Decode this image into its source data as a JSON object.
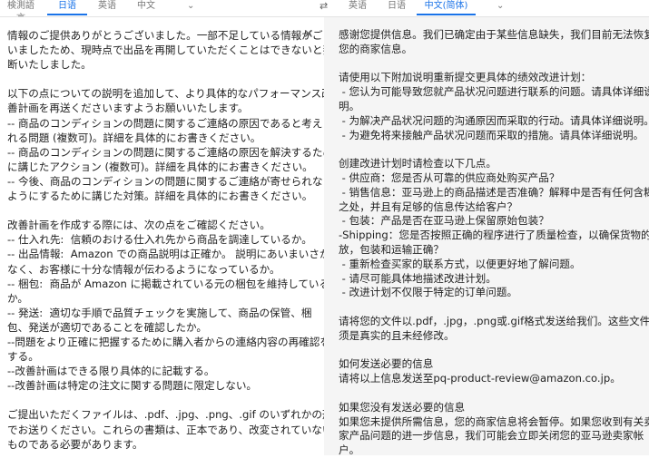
{
  "source_tabs": [
    "検測語言",
    "日语",
    "英语",
    "中文"
  ],
  "target_tabs": [
    "英语",
    "日语",
    "中文(简体)"
  ],
  "icons": {
    "swap": "swap-languages-icon",
    "chevron": "chevron-down-icon",
    "close": "close-icon"
  },
  "accent_color": "#1a73e8",
  "source_lines": [
    "情報のご提供ありがとうございました。一部不足している情報がござ",
    "いましたため、現時点で出品を再開していただくことはできないと判",
    "断いたしました。",
    "",
    "以下の点についての説明を追加して、より具体的なパフォーマンス改",
    "善計画を再送くださいますようお願いいたします。",
    "-- 商品のコンディションの問題に関するご連絡の原因であると考えら",
    "れる問題 (複数可)。詳細を具体的にお書きください。",
    "-- 商品のコンディションの問題に関するご連絡の原因を解決するため",
    "に講じたアクション (複数可)。詳細を具体的にお書きください。",
    "-- 今後、商品のコンディションの問題に関するご連絡が寄せられない",
    "ようにするために講じた対策。詳細を具体的にお書きください。",
    "",
    "改善計画を作成する際には、次の点をご確認ください。",
    "-- 仕入れ先:  信頼のおける仕入れ先から商品を調達しているか。",
    "-- 出品情報:  Amazon での商品説明は正確か。 説明にあいまいさが",
    "なく、お客様に十分な情報が伝わるようになっているか。",
    "-- 梱包:  商品が Amazon に掲載されている元の梱包を維持している",
    "か。",
    "-- 発送:  適切な手順で品質チェックを実施して、商品の保管、梱",
    "包、発送が適切であることを確認したか。",
    "--問題をより正確に把握するために購入者からの連絡内容の再確認を",
    "する。",
    "--改善計画はできる限り具体的に記載する。",
    "--改善計画は特定の注文に関する問題に限定しない。",
    "",
    "ご提出いただくファイルは、.pdf、.jpg、.png、.gif のいずれかの形式",
    "でお送りください。これらの書類は、正本であり、改変されていない",
    "ものである必要があります。"
  ],
  "target_lines": [
    "感谢您提供信息。我们已确定由于某些信息缺失，我们目前无法恢复",
    "您的商家信息。",
    "",
    "请使用以下附加说明重新提交更具体的绩效改进计划：",
    " - 您认为可能导致您就产品状况问题进行联系的问题。请具体详细说",
    "明。",
    " - 为解决产品状况问题的沟通原因而采取的行动。请具体详细说明。",
    " - 为避免将来接触产品状况问题而采取的措施。请具体详细说明。",
    "",
    "创建改进计划时请检查以下几点。",
    " - 供应商：您是否从可靠的供应商处购买产品？",
    " - 销售信息：亚马逊上的商品描述是否准确？解释中是否有任何含糊",
    "之处，并且有足够的信息传达给客户？",
    " - 包装：产品是否在亚马逊上保留原始包装？",
    "-Shipping：您是否按照正确的程序进行了质量检查，以确保货物的存",
    "放，包装和运输正确？",
    " - 重新检查买家的联系方式，以便更好地了解问题。",
    " - 请尽可能具体地描述改进计划。",
    " - 改进计划不仅限于特定的订单问题。",
    "",
    "请将您的文件以.pdf，.jpg，.png或.gif格式发送给我们。这些文件必",
    "须是真实的且未经修改。",
    "",
    "如何发送必要的信息",
    "请将以上信息发送至pq-product-review@amazon.co.jp。",
    "",
    "如果您没有发送必要的信息",
    "如果您未提供所需信息，您的商家信息将会暂停。如果您收到有关卖",
    "家产品问题的进一步信息，我们可能会立即关闭您的亚马逊卖家帐",
    "户。"
  ]
}
